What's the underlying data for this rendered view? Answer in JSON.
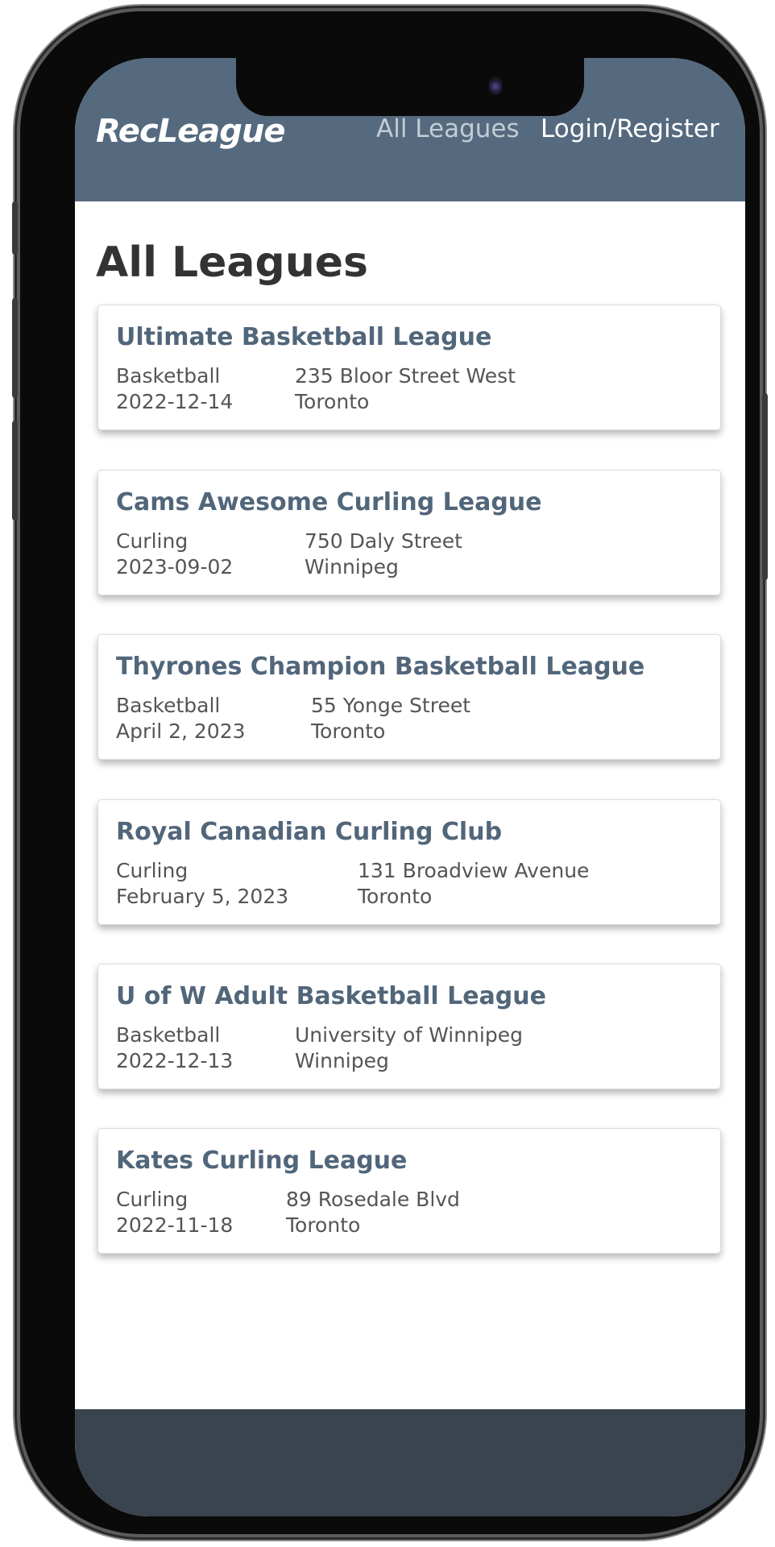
{
  "navbar": {
    "brand": "RecLeague",
    "links": [
      "All Leagues",
      "Login/Register"
    ]
  },
  "page": {
    "title": "All Leagues"
  },
  "leagues": [
    {
      "name": "Ultimate Basketball League",
      "sport": "Basketball",
      "date": "2022-12-14",
      "address": "235 Bloor Street West",
      "city": "Toronto"
    },
    {
      "name": "Cams Awesome Curling League",
      "sport": "Curling",
      "date": "2023-09-02",
      "address": "750 Daly Street",
      "city": "Winnipeg"
    },
    {
      "name": "Thyrones Champion Basketball League",
      "sport": "Basketball",
      "date": "April 2, 2023",
      "address": "55 Yonge Street",
      "city": "Toronto"
    },
    {
      "name": "Royal Canadian Curling Club",
      "sport": "Curling",
      "date": "February 5, 2023",
      "address": "131 Broadview Avenue",
      "city": "Toronto"
    },
    {
      "name": "U of W Adult Basketball League",
      "sport": "Basketball",
      "date": "2022-12-13",
      "address": "University of Winnipeg",
      "city": "Winnipeg"
    },
    {
      "name": "Kates Curling League",
      "sport": "Curling",
      "date": "2022-11-18",
      "address": "89 Rosedale Blvd",
      "city": "Toronto"
    }
  ],
  "colors": {
    "navbar": "#556a7e",
    "accent_title": "#52667a",
    "footer": "#3a444f"
  }
}
